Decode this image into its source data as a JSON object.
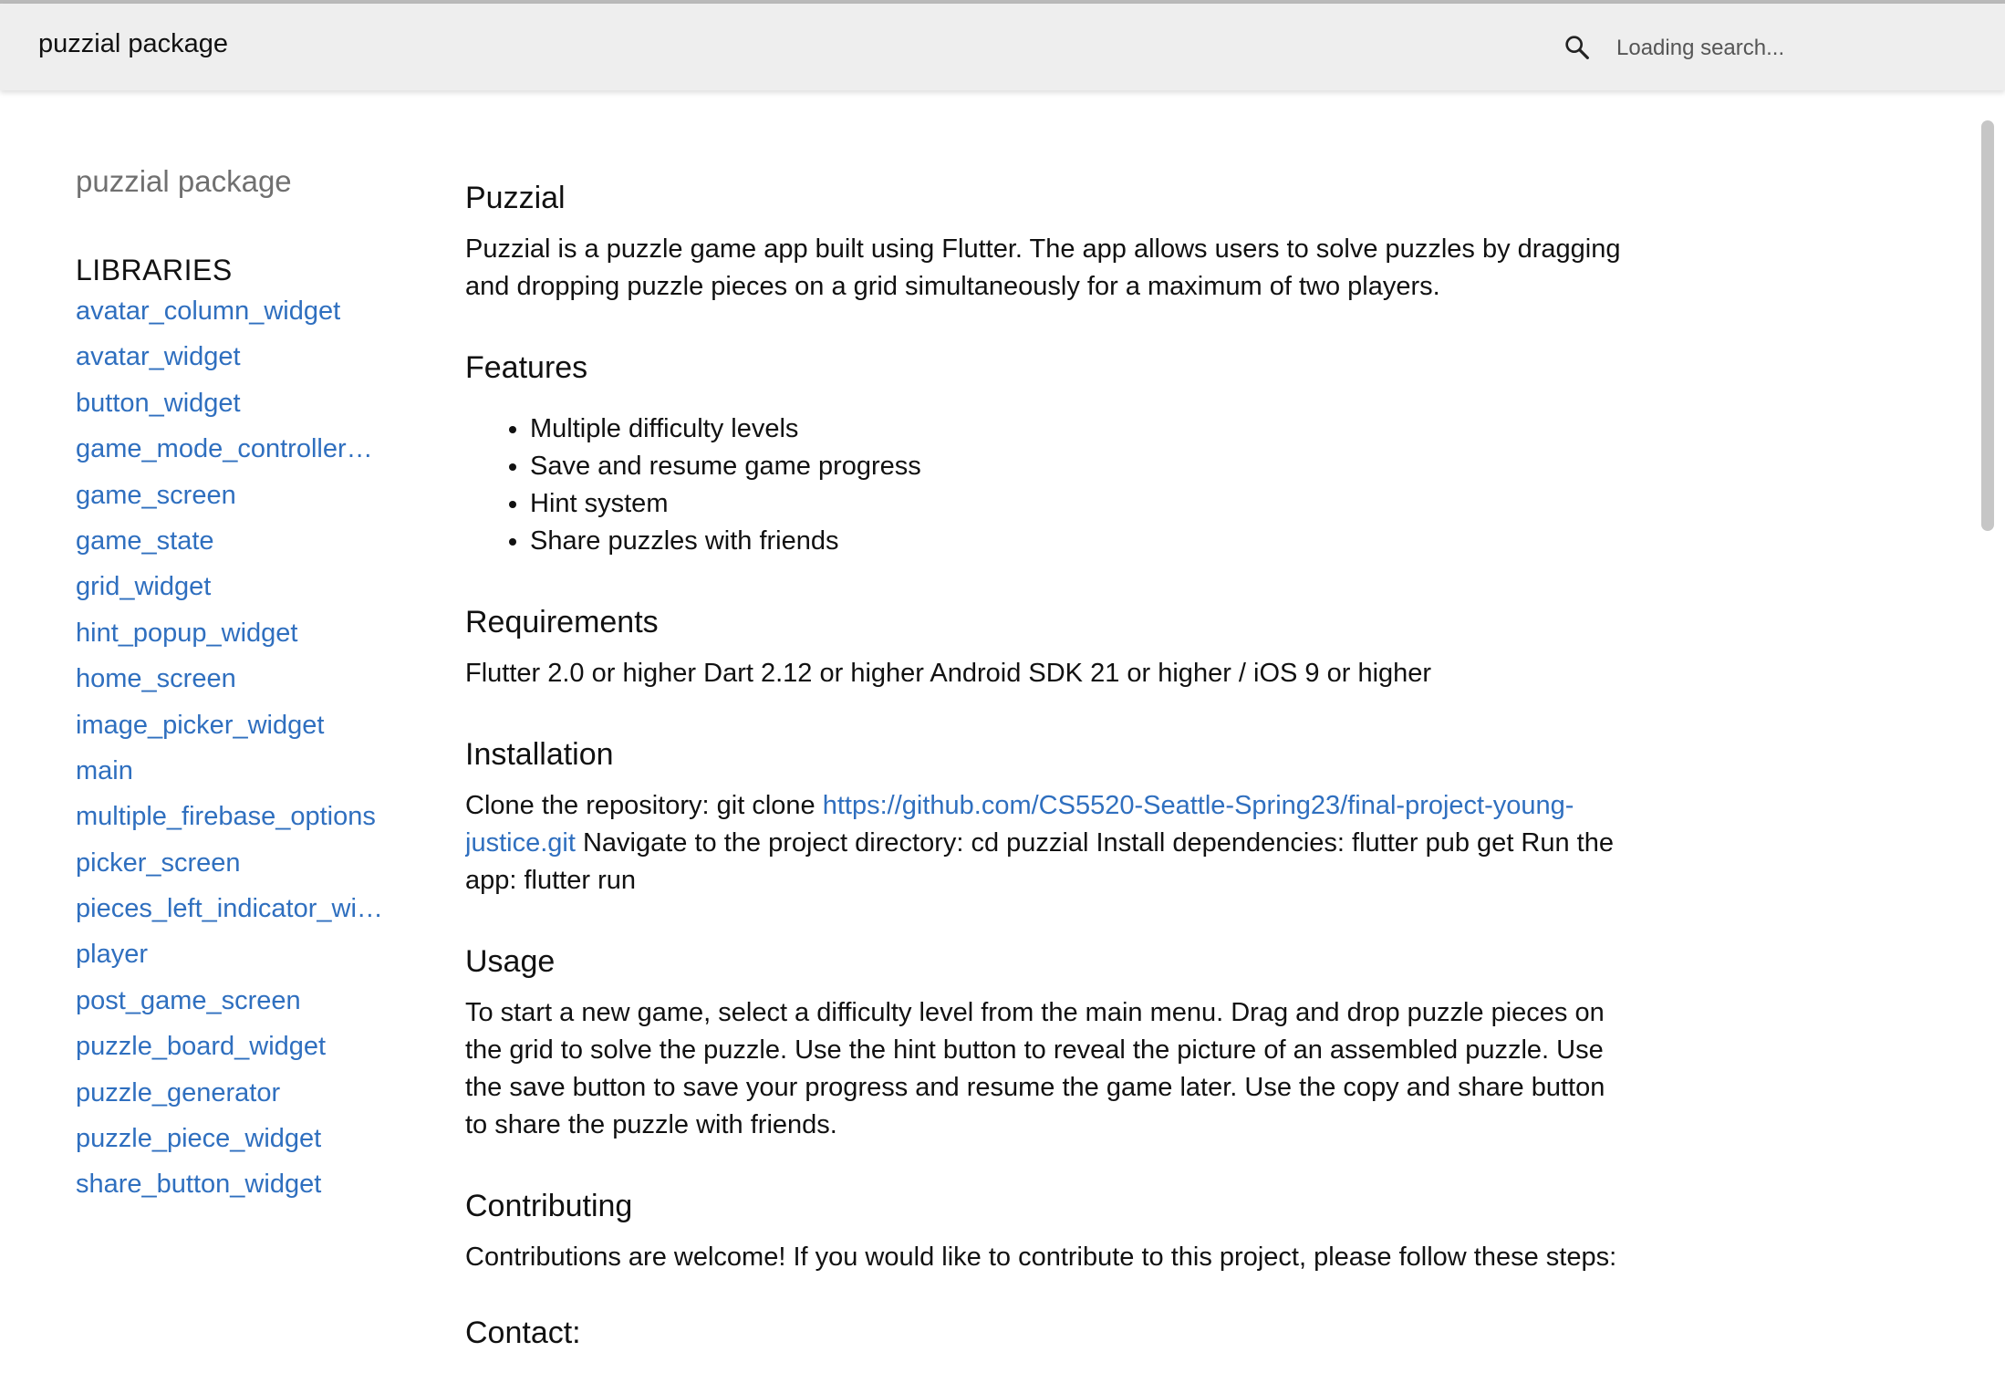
{
  "header": {
    "title": "puzzial package",
    "search_placeholder": "Loading search..."
  },
  "sidebar": {
    "package": "puzzial package",
    "heading": "LIBRARIES",
    "libraries": [
      "avatar_column_widget",
      "avatar_widget",
      "button_widget",
      "game_mode_controller_widget",
      "game_screen",
      "game_state",
      "grid_widget",
      "hint_popup_widget",
      "home_screen",
      "image_picker_widget",
      "main",
      "multiple_firebase_options",
      "picker_screen",
      "pieces_left_indicator_widget",
      "player",
      "post_game_screen",
      "puzzle_board_widget",
      "puzzle_generator",
      "puzzle_piece_widget",
      "share_button_widget"
    ]
  },
  "main": {
    "title": "Puzzial",
    "intro": "Puzzial is a puzzle game app built using Flutter. The app allows users to solve puzzles by dragging and dropping puzzle pieces on a grid simultaneously for a maximum of two players.",
    "features_heading": "Features",
    "features": [
      "Multiple difficulty levels",
      "Save and resume game progress",
      "Hint system",
      "Share puzzles with friends"
    ],
    "requirements_heading": "Requirements",
    "requirements": "Flutter 2.0 or higher Dart 2.12 or higher Android SDK 21 or higher / iOS 9 or higher",
    "installation_heading": "Installation",
    "installation_prefix": "Clone the repository: git clone ",
    "installation_link": "https://github.com/CS5520-Seattle-Spring23/final-project-young-justice.git",
    "installation_suffix": " Navigate to the project directory: cd puzzial Install dependencies: flutter pub get Run the app: flutter run",
    "usage_heading": "Usage",
    "usage": "To start a new game, select a difficulty level from the main menu. Drag and drop puzzle pieces on the grid to solve the puzzle. Use the hint button to reveal the picture of an assembled puzzle. Use the save button to save your progress and resume the game later. Use the copy and share button to share the puzzle with friends.",
    "contributing_heading": "Contributing",
    "contributing": "Contributions are welcome! If you would like to contribute to this project, please follow these steps:",
    "contact_heading": "Contact:"
  }
}
